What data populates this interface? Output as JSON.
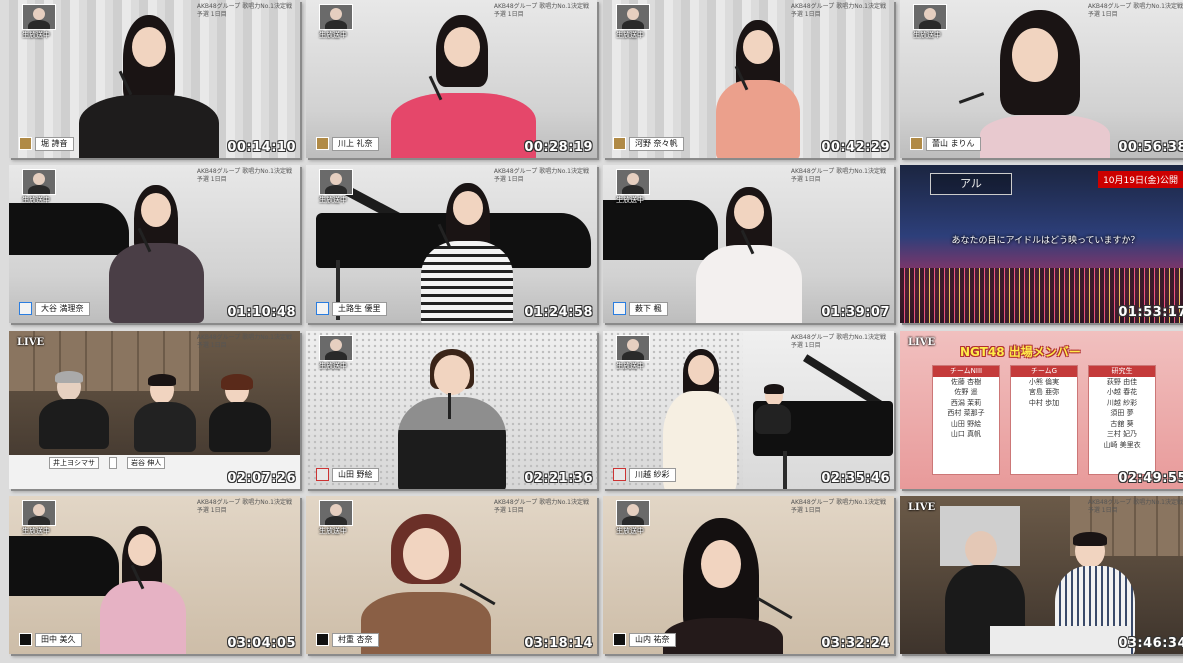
{
  "header_lines": [
    "AKB48グループ 歌唱力No.1決定戦",
    "予選 1日目"
  ],
  "cam_label": "生放送中",
  "live_label": "LIVE",
  "tiles": [
    {
      "name": "堀 詩音",
      "logo": "akb",
      "time": "00:14:10"
    },
    {
      "name": "川上 礼奈",
      "logo": "akb",
      "time": "00:28:19"
    },
    {
      "name": "河野 奈々帆",
      "logo": "akb",
      "time": "00:42:29"
    },
    {
      "name": "蕾山 まりん",
      "logo": "akb",
      "time": "00:56:38"
    },
    {
      "name": "大谷 満理奈",
      "logo": "stu",
      "time": "01:10:48"
    },
    {
      "name": "土路生 優里",
      "logo": "stu",
      "time": "01:24:58"
    },
    {
      "name": "薮下 楓",
      "logo": "stu",
      "time": "01:39:07"
    },
    {
      "name": "",
      "logo": "",
      "time": "01:53:17"
    },
    {
      "name": "",
      "logo": "",
      "time": "02:07:26"
    },
    {
      "name": "山田 野絵",
      "logo": "ngt",
      "time": "02:21:36"
    },
    {
      "name": "川越 紗彩",
      "logo": "ngt",
      "time": "02:35:46"
    },
    {
      "name": "",
      "logo": "",
      "time": "02:49:55"
    },
    {
      "name": "田中 美久",
      "logo": "hkt",
      "time": "03:04:05"
    },
    {
      "name": "村重 杏奈",
      "logo": "hkt",
      "time": "03:18:14"
    },
    {
      "name": "山内 祐奈",
      "logo": "hkt",
      "time": "03:32:24"
    },
    {
      "name": "",
      "logo": "",
      "time": "03:46:34"
    }
  ],
  "concert": {
    "caption_top": "アル",
    "caption_right": "10月19日(金)公開",
    "caption_mid": "あなたの目にアイドルはどう映っていますか？"
  },
  "panel": {
    "names": [
      "井上ヨシマサ",
      "",
      "岩谷 伸人"
    ]
  },
  "ngt": {
    "title": "NGT48 出場メンバー",
    "columns": [
      {
        "head": "チームNIII",
        "members": [
          "佐藤 杏樹",
          "佐野 遥",
          "西潟 茉莉",
          "西村 菜那子",
          "山田 野絵",
          "山口 真帆"
        ]
      },
      {
        "head": "チームG",
        "members": [
          "小熊 倫実",
          "宮島 亜弥",
          "中村 歩加"
        ]
      },
      {
        "head": "研究生",
        "members": [
          "荻野 由佳",
          "小越 春花",
          "川越 紗彩",
          "須田 夢",
          "古舘 葵",
          "三村 妃乃",
          "山崎 美里衣"
        ]
      }
    ]
  },
  "colors": {
    "logo_akb": "#b08a46",
    "logo_stu": "#2a7de0",
    "logo_ngt": "#c33333",
    "logo_hkt": "#111111"
  }
}
